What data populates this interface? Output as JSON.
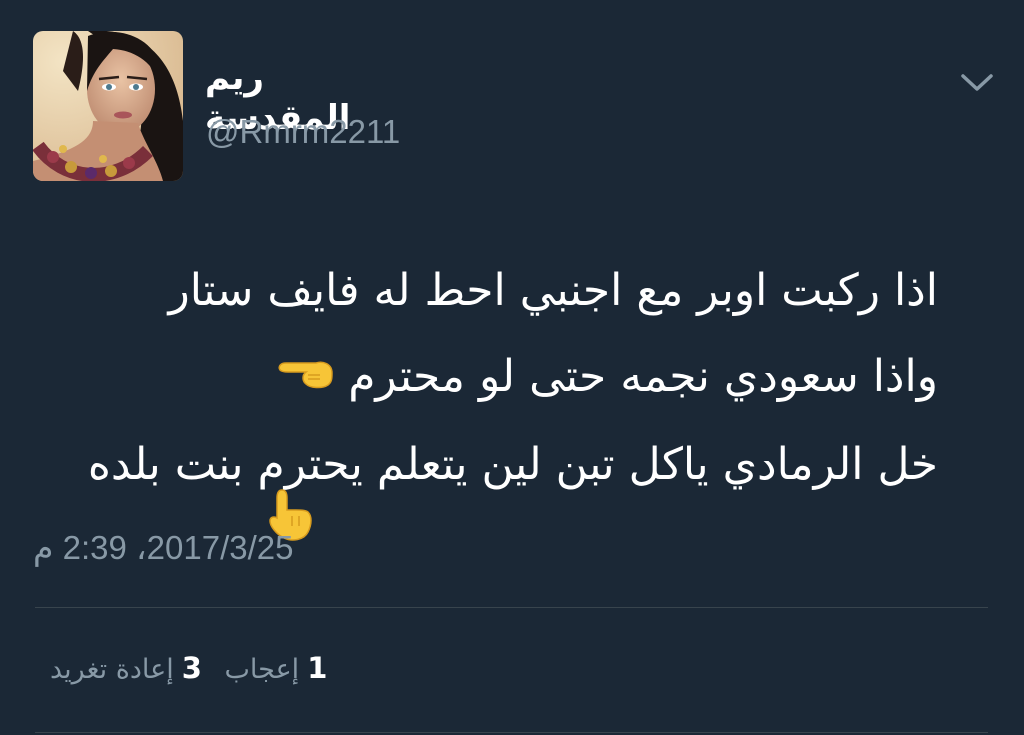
{
  "tweet": {
    "display_name": "ريم المقدسة",
    "handle": "@Rmrm2211",
    "text_lines": [
      "اذا ركبت اوبر مع اجنبي احط له فايف ستار",
      "واذا سعودي نجمه حتى لو محترم",
      "خل الرمادي ياكل تبن لين يتعلم يحترم بنت بلده"
    ],
    "timestamp": "2017/3/25، 2:39 م",
    "likes_count": "1",
    "likes_label": "إعجاب",
    "retweets_count": "3",
    "retweets_label": "إعادة تغريد",
    "icons": {
      "menu": "chevron-down-icon",
      "pointing_left": "backhand-index-pointing-left-emoji",
      "pointing_down": "backhand-index-pointing-down-emoji"
    }
  },
  "colors": {
    "background": "#1b2836",
    "text_primary": "#ffffff",
    "text_secondary": "#8899a6",
    "divider": "#38444d",
    "emoji_yellow": "#f7c537"
  }
}
